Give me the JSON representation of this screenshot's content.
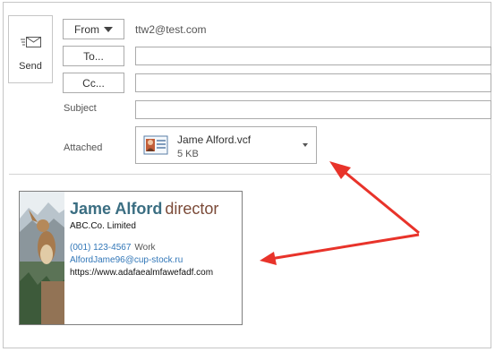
{
  "compose": {
    "send_label": "Send",
    "from_label": "From",
    "from_value": "ttw2@test.com",
    "to_label": "To...",
    "cc_label": "Cc...",
    "subject_label": "Subject",
    "attached_label": "Attached"
  },
  "attachment": {
    "file_name": "Jame Alford.vcf",
    "file_size": "5 KB",
    "icon": "vcard-icon"
  },
  "business_card": {
    "name": "Jame Alford",
    "title": "director",
    "company": "ABC.Co. Limited",
    "phone": "(001) 123-4567",
    "phone_type": "Work",
    "email": "AlfordJame96@cup-stock.ru",
    "website": "https://www.adafaealmfawefadf.com"
  },
  "colors": {
    "name": "#3b6e82",
    "title": "#7b4a38",
    "link": "#3277b8",
    "arrow": "#e8332a"
  }
}
